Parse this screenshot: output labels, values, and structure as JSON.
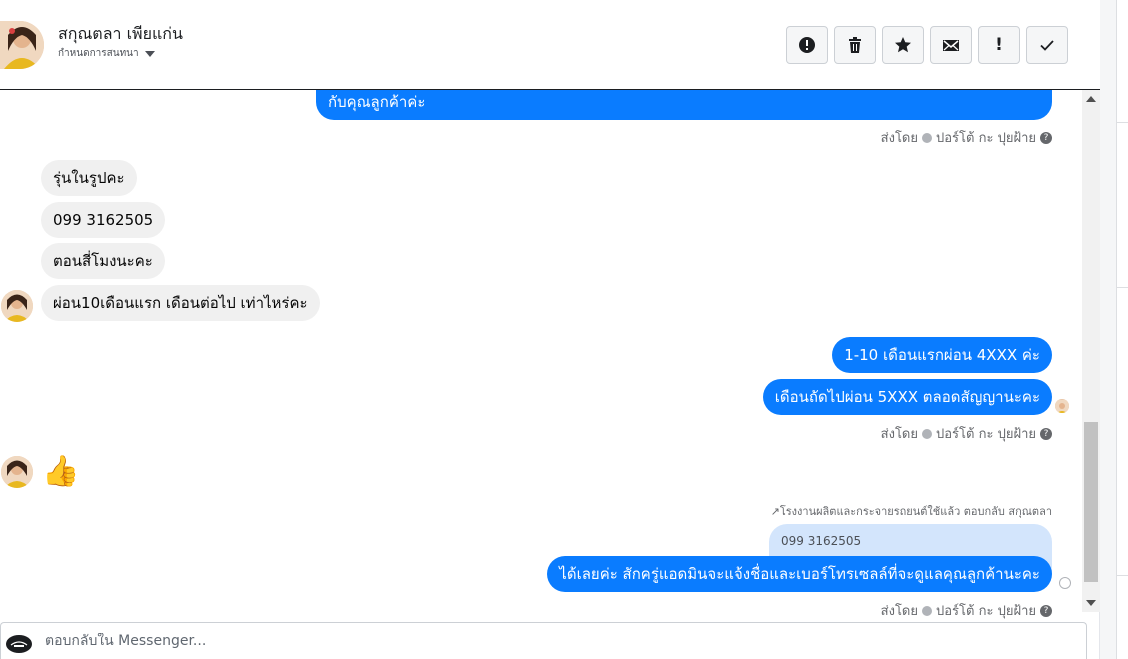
{
  "header": {
    "contact_name": "สกุณตลา เพียแก่น",
    "assign_label": "กำหนดการสนทนา"
  },
  "toolbar": {
    "buttons": [
      {
        "name": "spam-button",
        "icon": "alert-circle-icon"
      },
      {
        "name": "delete-button",
        "icon": "trash-icon"
      },
      {
        "name": "star-button",
        "icon": "star-icon"
      },
      {
        "name": "mark-unread-button",
        "icon": "envelope-icon"
      },
      {
        "name": "follow-up-button",
        "icon": "exclamation-icon",
        "label": "!"
      },
      {
        "name": "mark-done-button",
        "icon": "check-icon"
      }
    ]
  },
  "thread": {
    "messages": [
      {
        "direction": "out",
        "text": "กับคุณลูกค้าค่ะ"
      },
      {
        "direction": "in",
        "text": "รุ่นในรูปคะ"
      },
      {
        "direction": "in",
        "text": "099 3162505"
      },
      {
        "direction": "in",
        "text": "ตอนสี่โมงนะคะ"
      },
      {
        "direction": "in",
        "text": "ผ่อน10เดือนแรก  เดือนต่อไป เท่าไหร่คะ"
      },
      {
        "direction": "out",
        "text": "1-10 เดือนแรกผ่อน 4XXX ค่ะ"
      },
      {
        "direction": "out",
        "text": "เดือนถัดไปผ่อน 5XXX ตลอดสัญญานะคะ"
      },
      {
        "direction": "in",
        "text": "👍"
      },
      {
        "direction": "out",
        "text": "ได้เลยค่ะ สักครู่แอดมินจะแจ้งชื่อและเบอร์โทรเซลล์ที่จะดูแลคุณลูกค้านะคะ"
      }
    ],
    "sent_by_label": "ส่งโดย",
    "sender_name": "ปอร์โต้ กะ ปุยฝ้าย",
    "reply_note": "โรงงานผลิตและกระจายรถยนต์ใช้แล้ว ตอบกลับ สกุณตลา",
    "quoted_text": "099 3162505"
  },
  "composer": {
    "placeholder": "ตอบกลับใน Messenger..."
  },
  "colors": {
    "outgoing_bubble": "#0a7cff",
    "incoming_bubble": "#f0f0f0",
    "quoted_bubble": "#d3e5fc"
  }
}
